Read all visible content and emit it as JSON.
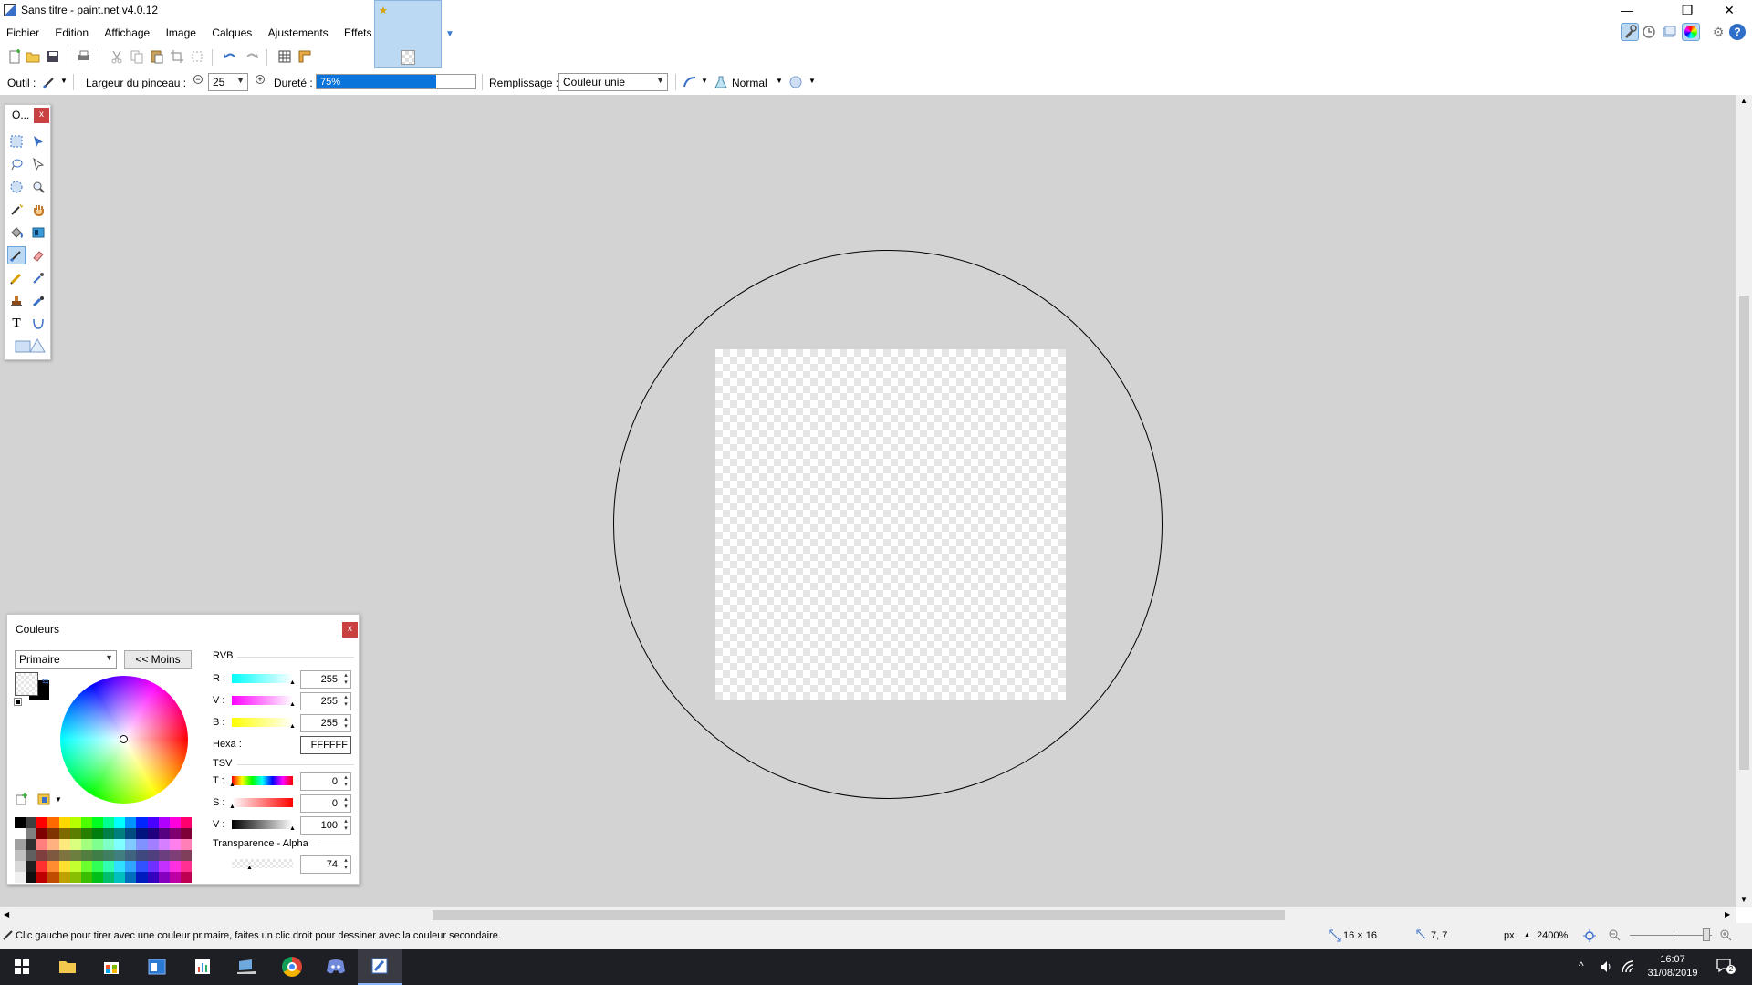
{
  "window": {
    "title": "Sans titre - paint.net v4.0.12"
  },
  "menu": [
    "Fichier",
    "Edition",
    "Affichage",
    "Image",
    "Calques",
    "Ajustements",
    "Effets"
  ],
  "options_bar": {
    "tool_label": "Outil :",
    "brush_width_label": "Largeur du pinceau :",
    "brush_width_value": "25",
    "hardness_label": "Dureté :",
    "hardness_value": "75%",
    "hardness_fraction": 0.75,
    "fill_label": "Remplissage :",
    "fill_value": "Couleur unie",
    "blend_mode": "Normal"
  },
  "tools_window": {
    "title": "O..."
  },
  "colors_window": {
    "title": "Couleurs",
    "mode_select": "Primaire",
    "less_button": "<< Moins",
    "rgb_header": "RVB",
    "r_label": "R :",
    "r_value": "255",
    "g_label": "V :",
    "g_value": "255",
    "b_label": "B :",
    "b_value": "255",
    "hex_label": "Hexa :",
    "hex_value": "FFFFFF",
    "hsv_header": "TSV",
    "h_label": "T :",
    "h_value": "0",
    "s_label": "S :",
    "s_value": "0",
    "v_label": "V :",
    "v_value": "100",
    "alpha_header": "Transparence - Alpha",
    "alpha_value": "74",
    "primary_color": "#FFFFFF",
    "secondary_color": "#000000"
  },
  "status_bar": {
    "hint": "Clic gauche pour tirer avec une couleur primaire, faites un clic droit pour dessiner avec la couleur secondaire.",
    "image_size": "16 × 16",
    "cursor_pos": "7, 7",
    "unit": "px",
    "zoom": "2400%"
  },
  "taskbar": {
    "time": "16:07",
    "date": "31/08/2019",
    "notifications": "2"
  },
  "palette_colors": [
    "#000000",
    "#404040",
    "#ff0000",
    "#ff6a00",
    "#ffd800",
    "#b6ff00",
    "#4cff00",
    "#00ff21",
    "#00ff90",
    "#00ffff",
    "#0094ff",
    "#0026ff",
    "#4800ff",
    "#b200ff",
    "#ff00dc",
    "#ff006e",
    "#ffffff",
    "#808080",
    "#7f0000",
    "#7f3300",
    "#7f6a00",
    "#5b7f00",
    "#267f00",
    "#007f0e",
    "#007f46",
    "#007f7f",
    "#004a7f",
    "#00137f",
    "#21007f",
    "#57007f",
    "#7f006e",
    "#7f0037",
    "#a0a0a0",
    "#303030",
    "#ff7f7f",
    "#ffb27f",
    "#ffe97f",
    "#daff7f",
    "#a5ff7f",
    "#7fff8e",
    "#7fffc5",
    "#7fffff",
    "#7fc9ff",
    "#7f92ff",
    "#a17fff",
    "#d67fff",
    "#ff7fed",
    "#ff7fb6",
    "#c0c0c0",
    "#606060",
    "#7f3f3f",
    "#7f593f",
    "#7f743f",
    "#6d7f3f",
    "#527f3f",
    "#3f7f47",
    "#3f7f62",
    "#3f7f7f",
    "#3f647f",
    "#3f497f",
    "#503f7f",
    "#6b3f7f",
    "#7f3f76",
    "#7f3f5b",
    "#d8d8d8",
    "#202020",
    "#ff3030",
    "#ff8c30",
    "#ffe030",
    "#c4ff30",
    "#6cff30",
    "#30ff55",
    "#30ffb0",
    "#30e0ff",
    "#30a4ff",
    "#3052ff",
    "#7030ff",
    "#c430ff",
    "#ff30e0",
    "#ff3090",
    "#f0f0f0",
    "#101010",
    "#bf0000",
    "#bf4c00",
    "#bfa200",
    "#88bf00",
    "#39bf00",
    "#00bf18",
    "#00bf6c",
    "#00bfbf",
    "#006ebf",
    "#001cbf",
    "#3600bf",
    "#8500bf",
    "#bf00a4",
    "#bf0052"
  ]
}
